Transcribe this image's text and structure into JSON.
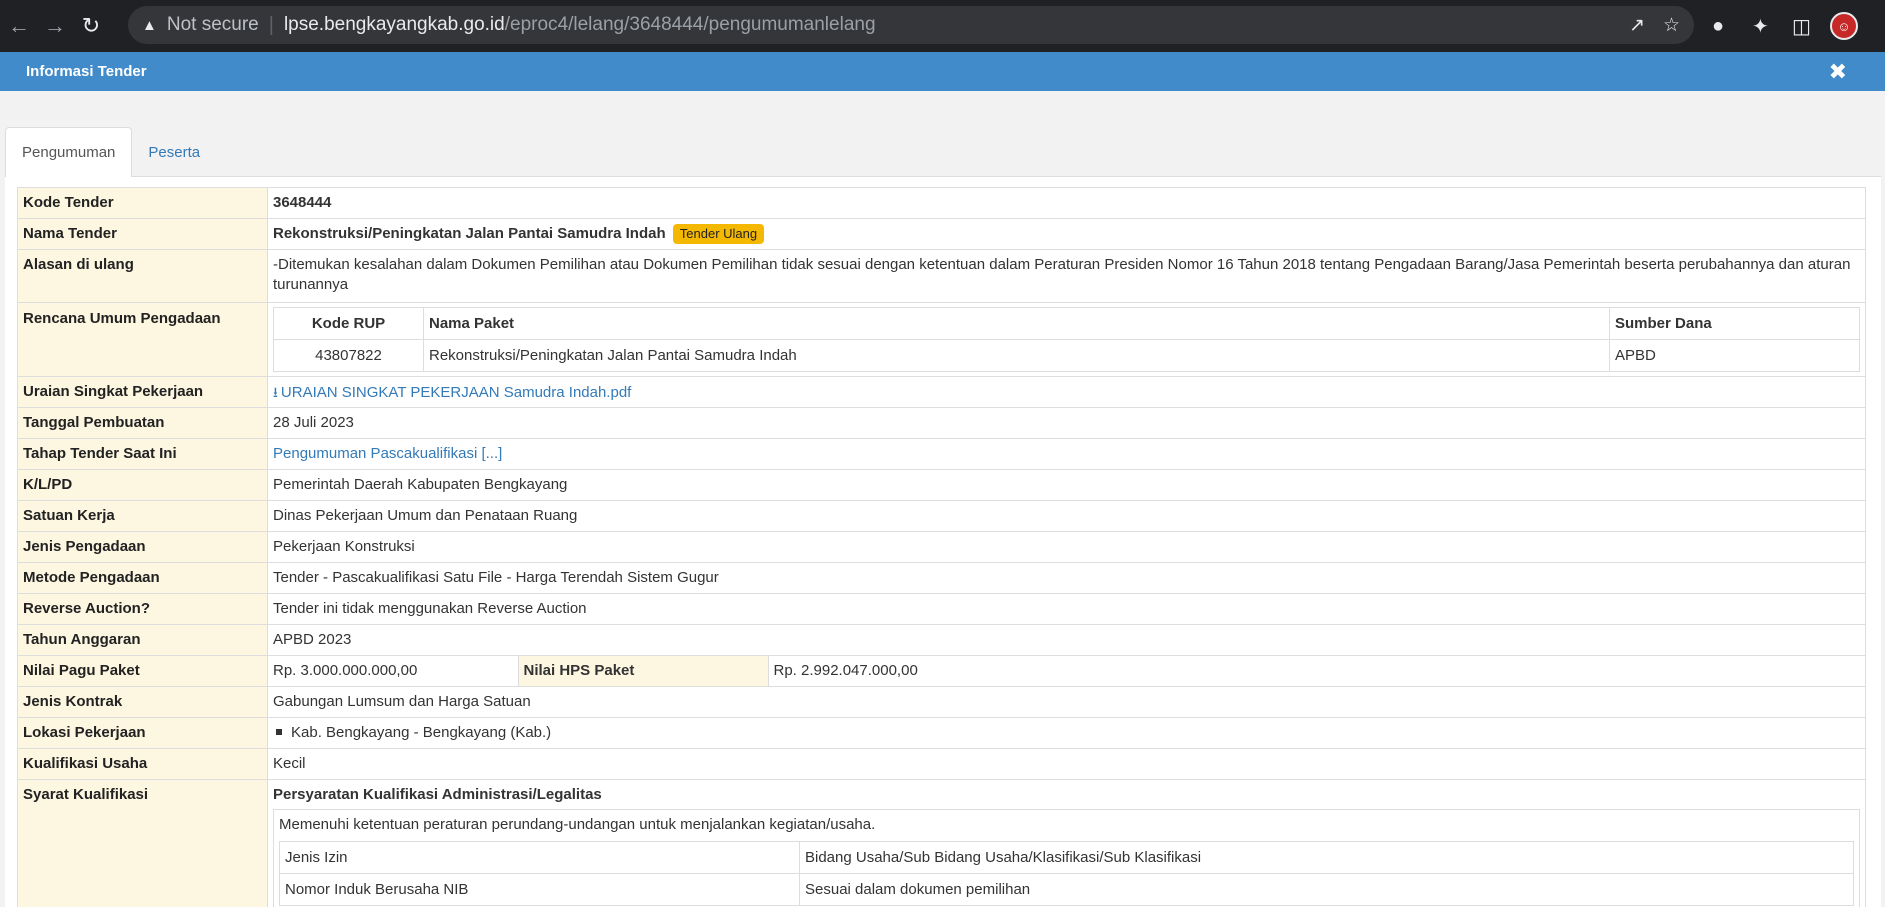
{
  "browser": {
    "security_label": "Not secure",
    "url_host": "lpse.bengkayangkab.go.id",
    "url_path": "/eproc4/lelang/3648444/pengumumanlelang"
  },
  "modal": {
    "title": "Informasi Tender"
  },
  "tabs": [
    {
      "label": "Pengumuman"
    },
    {
      "label": "Peserta"
    }
  ],
  "tender": {
    "rows": {
      "kode": {
        "label": "Kode Tender",
        "value": "3648444"
      },
      "nama": {
        "label": "Nama Tender",
        "value": "Rekonstruksi/Peningkatan Jalan Pantai Samudra Indah",
        "badge": "Tender Ulang"
      },
      "alasan": {
        "label": "Alasan di ulang",
        "value": "-Ditemukan kesalahan dalam Dokumen Pemilihan atau Dokumen Pemilihan tidak sesuai dengan ketentuan dalam Peraturan Presiden Nomor 16 Tahun 2018 tentang Pengadaan Barang/Jasa Pemerintah beserta perubahannya dan aturan turunannya"
      },
      "rup": {
        "label": "Rencana Umum Pengadaan",
        "headers": {
          "kode": "Kode RUP",
          "nama": "Nama Paket",
          "sumber": "Sumber Dana"
        },
        "row": {
          "kode": "43807822",
          "nama": "Rekonstruksi/Peningkatan Jalan Pantai Samudra Indah",
          "sumber": "APBD"
        }
      },
      "uraian": {
        "label": "Uraian Singkat Pekerjaan",
        "value": "URAIAN SINGKAT PEKERJAAN Samudra Indah.pdf"
      },
      "tanggal": {
        "label": "Tanggal Pembuatan",
        "value": "28 Juli 2023"
      },
      "tahap": {
        "label": "Tahap Tender Saat Ini",
        "value": "Pengumuman Pascakualifikasi [...]"
      },
      "klpd": {
        "label": "K/L/PD",
        "value": "Pemerintah Daerah Kabupaten Bengkayang"
      },
      "satker": {
        "label": "Satuan Kerja",
        "value": "Dinas Pekerjaan Umum dan Penataan Ruang"
      },
      "jenis": {
        "label": "Jenis Pengadaan",
        "value": "Pekerjaan Konstruksi"
      },
      "metode": {
        "label": "Metode Pengadaan",
        "value": "Tender - Pascakualifikasi Satu File - Harga Terendah Sistem Gugur"
      },
      "reverse": {
        "label": "Reverse Auction?",
        "value": "Tender ini tidak menggunakan Reverse Auction"
      },
      "tahun": {
        "label": "Tahun Anggaran",
        "value": "APBD 2023"
      },
      "pagu": {
        "label": "Nilai Pagu Paket",
        "value": "Rp. 3.000.000.000,00",
        "hps_label": "Nilai HPS Paket",
        "hps_value": "Rp. 2.992.047.000,00"
      },
      "kontrak": {
        "label": "Jenis Kontrak",
        "value": "Gabungan Lumsum dan Harga Satuan"
      },
      "lokasi": {
        "label": "Lokasi Pekerjaan",
        "value": "Kab. Bengkayang - Bengkayang (Kab.)"
      },
      "kualifikasi": {
        "label": "Kualifikasi Usaha",
        "value": "Kecil"
      },
      "syarat": {
        "label": "Syarat Kualifikasi",
        "heading": "Persyaratan Kualifikasi Administrasi/Legalitas",
        "desc": "Memenuhi ketentuan peraturan perundang-undangan untuk menjalankan kegiatan/usaha.",
        "izin_rows": [
          {
            "c1": "Jenis Izin",
            "c2": "Bidang Usaha/Sub Bidang Usaha/Klasifikasi/Sub Klasifikasi"
          },
          {
            "c1": "Nomor Induk Berusaha NIB",
            "c2": "Sesuai dalam dokumen pemilihan"
          }
        ]
      }
    }
  }
}
